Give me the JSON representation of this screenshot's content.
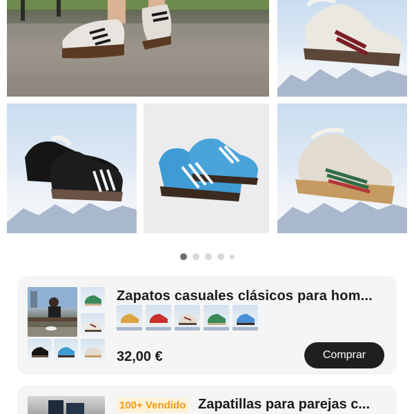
{
  "gallery": {
    "images": [
      {
        "alt": "person-wearing-white-sneakers-on-street"
      },
      {
        "alt": "white-sneaker-red-stripes"
      },
      {
        "alt": "black-sneakers-pair"
      },
      {
        "alt": "blue-sneakers-pair"
      },
      {
        "alt": "beige-sneaker-green-red-stripes"
      }
    ],
    "page_count": 5,
    "active_page": 1
  },
  "product1": {
    "title": "Zapatos casuales clásicos para hom...",
    "price": "32,00 €",
    "buy_label": "Comprar",
    "variant_colors": [
      "#d9a441",
      "#c9302c",
      "#e4dccf",
      "#3b8a5a",
      "#4a90d9"
    ]
  },
  "product2": {
    "badge": "100+ Vendido",
    "title": "Zapatillas para parejas c..."
  },
  "colors": {
    "buy_button": "#1f1f1f",
    "badge_text": "#f09c12",
    "badge_bg": "#fff1d6",
    "card_bg": "#f5f5f5"
  }
}
